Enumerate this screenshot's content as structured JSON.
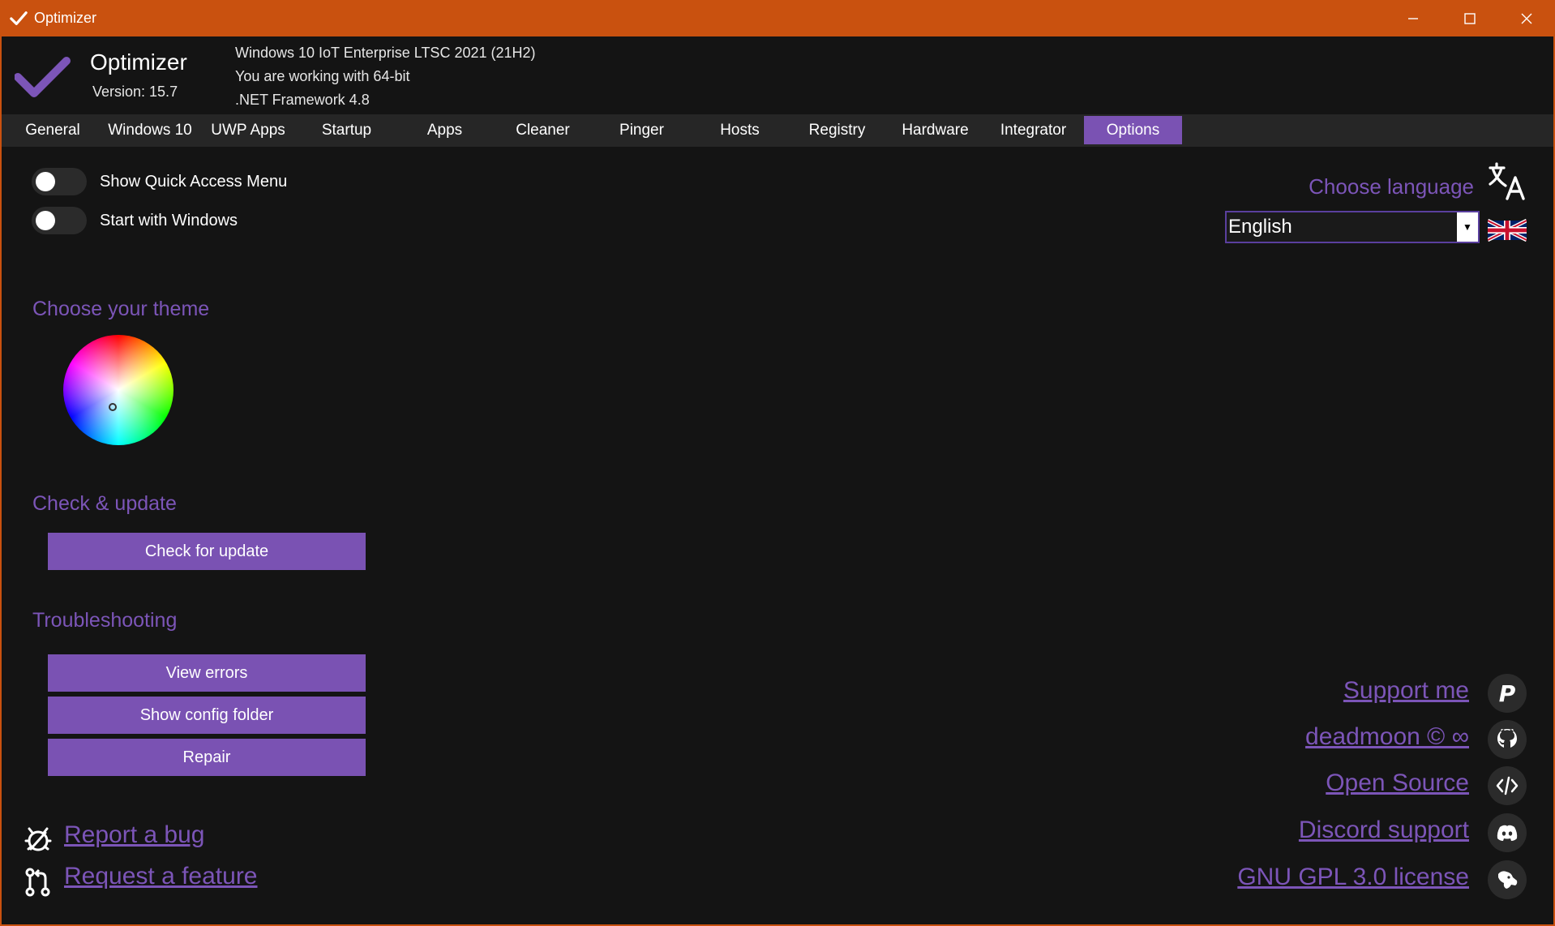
{
  "window": {
    "title": "Optimizer"
  },
  "header": {
    "app_name": "Optimizer",
    "version": "Version: 15.7",
    "os": "Windows 10 IoT Enterprise LTSC 2021 (21H2)",
    "bitness": "You are working with 64-bit",
    "framework": ".NET Framework 4.8"
  },
  "tabs": [
    {
      "label": "General"
    },
    {
      "label": "Windows 10"
    },
    {
      "label": "UWP Apps"
    },
    {
      "label": "Startup"
    },
    {
      "label": "Apps"
    },
    {
      "label": "Cleaner"
    },
    {
      "label": "Pinger"
    },
    {
      "label": "Hosts"
    },
    {
      "label": "Registry"
    },
    {
      "label": "Hardware"
    },
    {
      "label": "Integrator"
    },
    {
      "label": "Options",
      "active": true
    }
  ],
  "options": {
    "quick_access_label": "Show Quick Access Menu",
    "quick_access_on": false,
    "start_with_windows_label": "Start with Windows",
    "start_with_windows_on": false
  },
  "theme": {
    "title": "Choose your theme"
  },
  "update": {
    "title": "Check & update",
    "check_button": "Check for update"
  },
  "troubleshooting": {
    "title": "Troubleshooting",
    "view_errors": "View errors",
    "show_config_folder": "Show config folder",
    "repair": "Repair"
  },
  "language": {
    "title": "Choose language",
    "selected": "English"
  },
  "links": {
    "support": "Support me",
    "author": "deadmoon © ∞",
    "open_source": "Open Source",
    "discord": "Discord support",
    "license": "GNU GPL 3.0 license",
    "report_bug": "Report a bug",
    "request_feature": "Request a feature"
  },
  "colors": {
    "title_bar": "#C9510F",
    "accent": "#7A52B3",
    "link": "#7C55B8",
    "background": "#141414",
    "tab_strip": "#262626"
  }
}
